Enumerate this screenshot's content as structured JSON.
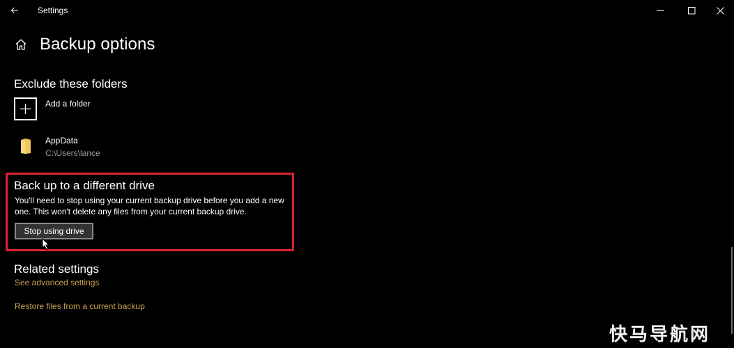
{
  "window": {
    "app_title": "Settings"
  },
  "page": {
    "title": "Backup options"
  },
  "exclude": {
    "heading": "Exclude these folders",
    "add_label": "Add a folder",
    "folders": [
      {
        "name": "AppData",
        "path": "C:\\Users\\lance"
      }
    ]
  },
  "different_drive": {
    "heading": "Back up to a different drive",
    "description": "You'll need to stop using your current backup drive before you add a new one. This won't delete any files from your current backup drive.",
    "button_label": "Stop using drive"
  },
  "related": {
    "heading": "Related settings",
    "links": [
      "See advanced settings",
      "Restore files from a current backup"
    ]
  },
  "watermark": "快马导航网",
  "colors": {
    "background": "#000000",
    "link": "#c8a14f",
    "highlight": "#d9232e",
    "folder": "#f3c959"
  }
}
